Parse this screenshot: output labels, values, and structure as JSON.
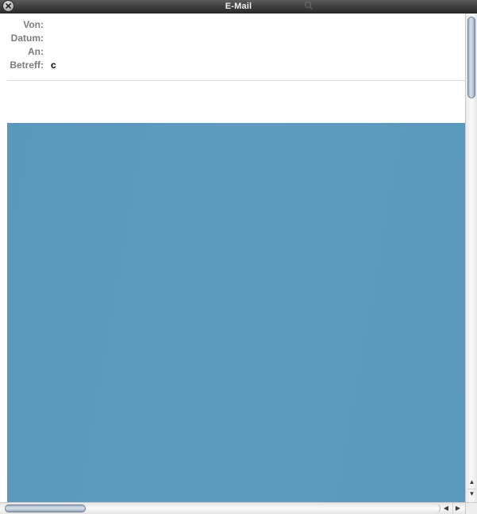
{
  "window": {
    "title": "E-Mail",
    "close_icon": "close-icon",
    "search_icon": "search-icon"
  },
  "message": {
    "fields": [
      {
        "label": "Von:",
        "value": ""
      },
      {
        "label": "Datum:",
        "value": ""
      },
      {
        "label": "An:",
        "value": ""
      },
      {
        "label": "Betreff:",
        "value": "c"
      }
    ]
  },
  "scrollbars": {
    "vertical": {
      "up_icon": "arrow-up-icon",
      "down_icon": "arrow-down-icon"
    },
    "horizontal": {
      "left_icon": "arrow-left-icon",
      "right_icon": "arrow-right-icon"
    }
  },
  "colors": {
    "titlebar": "#3d3d3d",
    "label_gray": "#7b7b7b",
    "image_blue": "#5f9bc0"
  }
}
